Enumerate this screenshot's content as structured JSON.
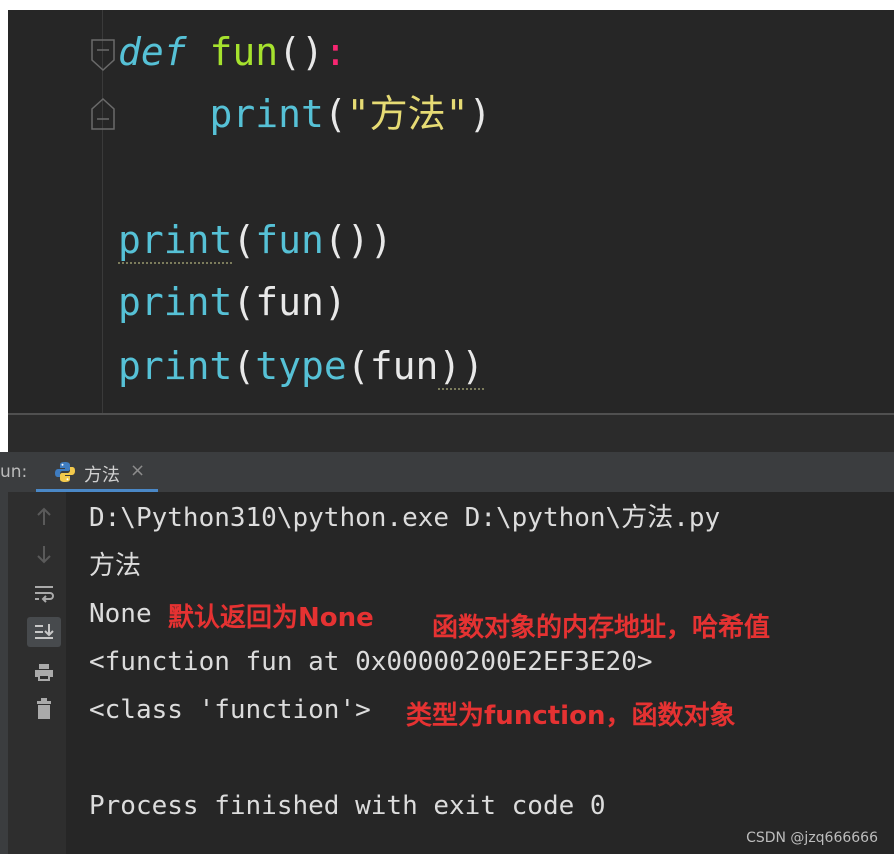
{
  "editor": {
    "line1": {
      "keyword": "def",
      "name": "fun",
      "parens": "()",
      "colon": ":"
    },
    "line2": {
      "indent": "    ",
      "func": "print",
      "open": "(",
      "string": "\"方法\"",
      "close": ")"
    },
    "line4": {
      "func": "print",
      "open": "(",
      "arg": "fun",
      "args_parens": "()",
      "close": ")"
    },
    "line5": {
      "func": "print",
      "open": "(",
      "arg": "fun",
      "close": ")"
    },
    "line6": {
      "func": "print",
      "open": "(",
      "inner_func": "type",
      "inner_open": "(",
      "arg": "fun",
      "close": "))"
    }
  },
  "run_panel": {
    "run_label": "un:",
    "tab": {
      "label": "方法",
      "close": "×",
      "icon": "python-icon"
    },
    "tools": [
      "arrow-up-icon",
      "arrow-down-icon",
      "soft-wrap-icon",
      "scroll-to-end-icon",
      "print-icon",
      "trash-icon"
    ]
  },
  "console": {
    "lines": [
      "D:\\Python310\\python.exe D:\\python\\方法.py",
      "方法",
      "None",
      "<function fun at 0x00000200E2EF3E20>",
      "<class 'function'>",
      "",
      "Process finished with exit code 0"
    ]
  },
  "annotations": {
    "none_note": "默认返回为None",
    "address_note": "函数对象的内存地址，哈希值",
    "class_note": "类型为function，函数对象"
  },
  "watermark": "CSDN @jzq666666",
  "colors": {
    "editor_bg": "#262626",
    "annotation": "#e53232",
    "accent": "#4a88c7"
  }
}
